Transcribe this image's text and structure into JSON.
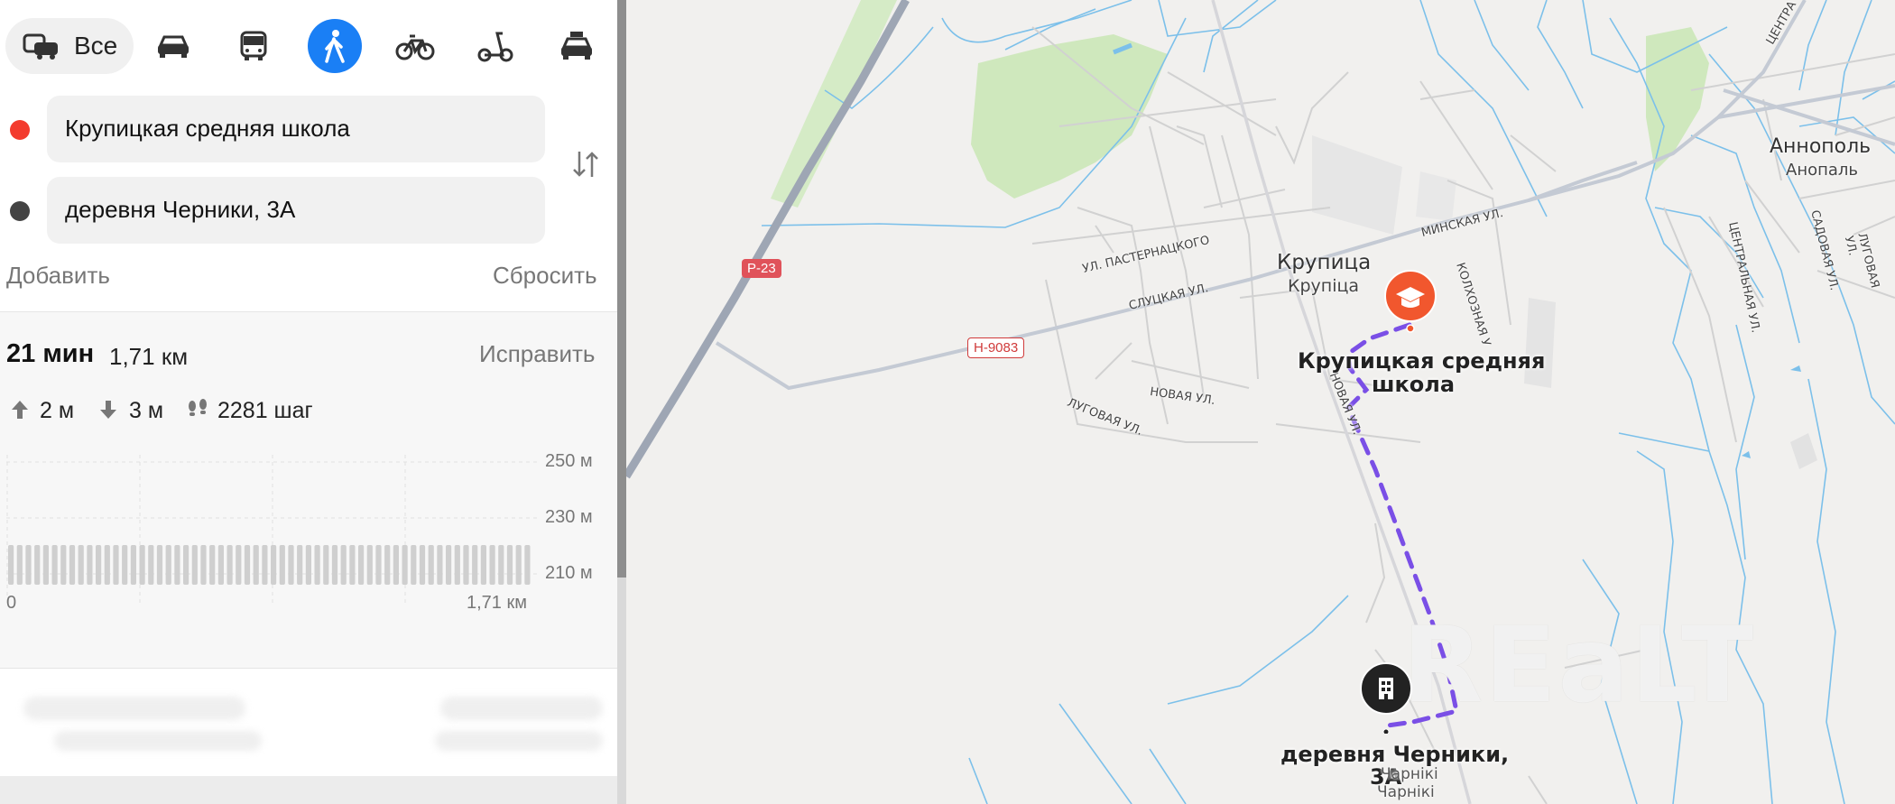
{
  "modes": {
    "all_label": "Все",
    "items": [
      {
        "icon": "car-icon",
        "active": false
      },
      {
        "icon": "bus-icon",
        "active": false
      },
      {
        "icon": "walking-icon",
        "active": true
      },
      {
        "icon": "bicycle-icon",
        "active": false
      },
      {
        "icon": "scooter-icon",
        "active": false
      },
      {
        "icon": "taxi-icon",
        "active": false
      }
    ]
  },
  "route": {
    "from": "Крупицкая средняя школа",
    "to": "деревня Черники, 3А",
    "add_label": "Добавить",
    "reset_label": "Сбросить"
  },
  "summary": {
    "time": "21 мин",
    "distance": "1,71 км",
    "fix_label": "Исправить",
    "ascent": "2 м",
    "descent": "3 м",
    "steps": "2281 шаг"
  },
  "elevation_chart": {
    "y_labels": [
      "250 м",
      "230 м",
      "210 м"
    ],
    "x_start": "0",
    "x_end": "1,71 км"
  },
  "map": {
    "road_p23": "Р-23",
    "road_h9083": "Н-9083",
    "town_ru": "Крупица",
    "town_by": "Крупіца",
    "anopol_ru": "Аннополь",
    "anopol_by": "Анопаль",
    "school_label_line1": "Крупицкая средняя",
    "school_label_line2": "школа",
    "dest_label_line1": "деревня Черники,",
    "dest_label_line2": "3А",
    "dest_by_line1": "Чарнікі",
    "dest_by_line2": "Чарнікі",
    "streets": {
      "minskaya": "МИНСКАЯ УЛ.",
      "pasternatskogo": "УЛ. ПАСТЕРНАЦКОГО",
      "slutskaya": "СЛУЦКАЯ УЛ.",
      "novaya": "НОВАЯ УЛ.",
      "novaya_vertical": "НОВАЯ УЛ.",
      "lugovaya": "ЛУГОВАЯ УЛ.",
      "kolkhoznaya": "КОЛХОЗНАЯ У",
      "tsentralnaya": "ЦЕНТРАЛЬНАЯ УЛ.",
      "sadovaya": "САДОВАЯ УЛ.",
      "lugovaya_right": "ЛУГОВАЯ УЛ.",
      "tsentra_top": "ЦЕНТРА"
    },
    "watermark": "REaLT",
    "colors": {
      "route": "#7a4fe6",
      "school_pin": "#f1572e",
      "walking_active": "#1a7ff5"
    }
  }
}
